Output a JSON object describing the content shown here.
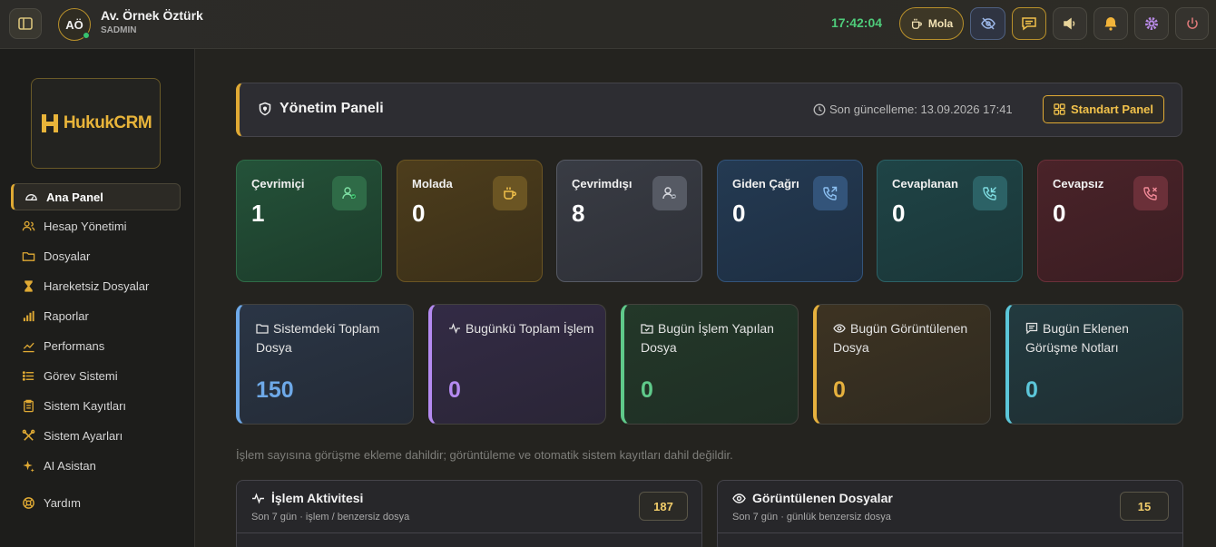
{
  "topbar": {
    "avatar_initials": "AÖ",
    "user_name": "Av. Örnek Öztürk",
    "user_role": "SADMIN",
    "clock": "17:42:04",
    "break_label": "Mola"
  },
  "sidebar": {
    "logo_text": "HukukCRM",
    "items": [
      {
        "label": "Ana Panel",
        "icon": "dashboard-icon",
        "active": true
      },
      {
        "label": "Hesap Yönetimi",
        "icon": "users-icon"
      },
      {
        "label": "Dosyalar",
        "icon": "folder-icon"
      },
      {
        "label": "Hareketsiz Dosyalar",
        "icon": "hourglass-icon"
      },
      {
        "label": "Raporlar",
        "icon": "bar-chart-icon"
      },
      {
        "label": "Performans",
        "icon": "trend-icon"
      },
      {
        "label": "Görev Sistemi",
        "icon": "list-icon"
      },
      {
        "label": "Sistem Kayıtları",
        "icon": "clipboard-icon"
      },
      {
        "label": "Sistem Ayarları",
        "icon": "tools-icon"
      },
      {
        "label": "AI Asistan",
        "icon": "sparkle-icon"
      },
      {
        "label": "Yardım",
        "icon": "lifebuoy-icon"
      }
    ]
  },
  "header": {
    "title": "Yönetim Paneli",
    "last_update": "Son güncelleme: 13.09.2026 17:41",
    "standard_panel_label": "Standart Panel"
  },
  "stats": [
    {
      "label": "Çevrimiçi",
      "value": "1",
      "color": "#3fbf6e"
    },
    {
      "label": "Molada",
      "value": "0",
      "color": "#e0aa34"
    },
    {
      "label": "Çevrimdışı",
      "value": "8",
      "color": "#9aa0aa"
    },
    {
      "label": "Giden Çağrı",
      "value": "0",
      "color": "#5aa0e6"
    },
    {
      "label": "Cevaplanan",
      "value": "0",
      "color": "#3cc2c9"
    },
    {
      "label": "Cevapsız",
      "value": "0",
      "color": "#e25a6a"
    }
  ],
  "info_cards": [
    {
      "label": "Sistemdeki Toplam Dosya",
      "value": "150",
      "color": "#6ea9e8"
    },
    {
      "label": "Bugünkü Toplam İşlem",
      "value": "0",
      "color": "#b48af0"
    },
    {
      "label": "Bugün İşlem Yapılan Dosya",
      "value": "0",
      "color": "#5fc98a"
    },
    {
      "label": "Bugün Görüntülenen Dosya",
      "value": "0",
      "color": "#e6b13e"
    },
    {
      "label": "Bugün Eklenen Görüşme Notları",
      "value": "0",
      "color": "#5cc6d9"
    }
  ],
  "note": "İşlem sayısına görüşme ekleme dahildir; görüntüleme ve otomatik sistem kayıtları dahil değildir.",
  "panels": [
    {
      "title": "İşlem Aktivitesi",
      "subtitle": "Son 7 gün · işlem / benzersiz dosya",
      "count": "187"
    },
    {
      "title": "Görüntülenen Dosyalar",
      "subtitle": "Son 7 gün · günlük benzersiz dosya",
      "count": "15"
    }
  ]
}
